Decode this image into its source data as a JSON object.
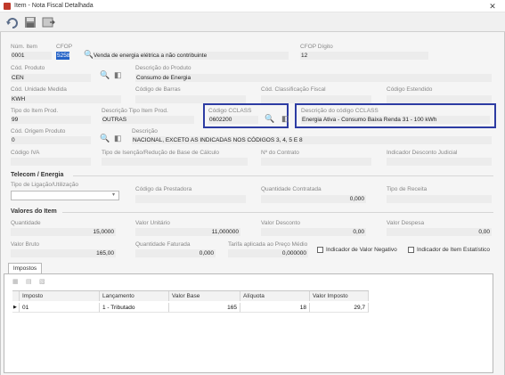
{
  "window": {
    "title": "Item - Nota Fiscal Detalhada",
    "close": "✕"
  },
  "fields": {
    "num_item": {
      "label": "Núm. Item",
      "value": "0001"
    },
    "cfop": {
      "label": "CFOP",
      "value": "5258",
      "desc": "Venda de energia elétrica a não contribuinte"
    },
    "cfop_digito": {
      "label": "CFOP Dígito",
      "value": "12"
    },
    "cod_produto": {
      "label": "Cód. Produto",
      "value": "CEN"
    },
    "desc_produto": {
      "label": "Descrição do Produto",
      "value": "Consumo de Energia"
    },
    "cod_unidade": {
      "label": "Cód. Unidade Medida",
      "value": "KWH"
    },
    "cod_barras": {
      "label": "Código de Barras",
      "value": ""
    },
    "cod_class_fiscal": {
      "label": "Cód. Classificação Fiscal",
      "value": ""
    },
    "cod_estendido": {
      "label": "Código Estendido",
      "value": ""
    },
    "tipo_item_prod": {
      "label": "Tipo do Item Prod.",
      "value": "99"
    },
    "desc_tipo_item": {
      "label": "Descrição Tipo Item Prod.",
      "value": "OUTRAS"
    },
    "cod_cclass": {
      "label": "Código CCLASS",
      "value": "0602200"
    },
    "desc_cclass": {
      "label": "Descrição do código CCLASS",
      "value": "Energia Ativa - Consumo Baixa Renda 31 - 100 kWh"
    },
    "cod_origem": {
      "label": "Cód. Origem Produto",
      "value": "0"
    },
    "desc_origem": {
      "label": "Descrição",
      "value": "NACIONAL, EXCETO AS INDICADAS NOS CÓDIGOS 3, 4, 5 E 8"
    },
    "codigo_iva": {
      "label": "Código IVA",
      "value": ""
    },
    "tipo_isencao": {
      "label": "Tipo de Isenção/Redução de Base de Cálculo",
      "value": ""
    },
    "num_contrato": {
      "label": "Nº do Contrato",
      "value": ""
    },
    "ind_desconto": {
      "label": "Indicador Desconto Judicial",
      "value": ""
    }
  },
  "telecom": {
    "title": "Telecom / Energia",
    "tipo_ligacao": {
      "label": "Tipo de Ligação/Utilização",
      "value": ""
    },
    "cod_prestadora": {
      "label": "Código da Prestadora",
      "value": ""
    },
    "qtd_contratada": {
      "label": "Quantidade Contratada",
      "value": "0,000"
    },
    "tipo_receita": {
      "label": "Tipo de Receita",
      "value": ""
    }
  },
  "valores": {
    "title": "Valores do Item",
    "quantidade": {
      "label": "Quantidade",
      "value": "15,0000"
    },
    "valor_unitario": {
      "label": "Valor Unitário",
      "value": "11,000000"
    },
    "valor_desconto": {
      "label": "Valor Desconto",
      "value": "0,00"
    },
    "valor_despesa": {
      "label": "Valor Despesa",
      "value": "0,00"
    },
    "valor_bruto": {
      "label": "Valor Bruto",
      "value": "165,00"
    },
    "qtd_faturada": {
      "label": "Quantidade Faturada",
      "value": "0,000"
    },
    "tarifa": {
      "label": "Tarifa aplicada ao Preço Médio",
      "value": "0,000000"
    },
    "ind_valor_negativo": "Indicador de Valor Negativo",
    "ind_item_estatistico": "Indicador de Item Estatístico"
  },
  "impostos": {
    "tab_label": "Impostos",
    "columns": [
      "Imposto",
      "Lançamento",
      "Valor Base",
      "Alíquota",
      "Valor Imposto"
    ],
    "rows": [
      {
        "imposto": "01",
        "lancamento": "1 - Tributado",
        "valor_base": "165",
        "aliquota": "18",
        "valor_imposto": "29,7"
      }
    ]
  },
  "icons": [
    "app-icon",
    "close-icon",
    "undo-icon",
    "save-icon",
    "close-window-icon",
    "search-icon",
    "eraser-icon",
    "dropdown-arrow-icon",
    "row-pointer-icon",
    "grid-add-icon",
    "grid-edit-icon",
    "grid-delete-icon"
  ]
}
